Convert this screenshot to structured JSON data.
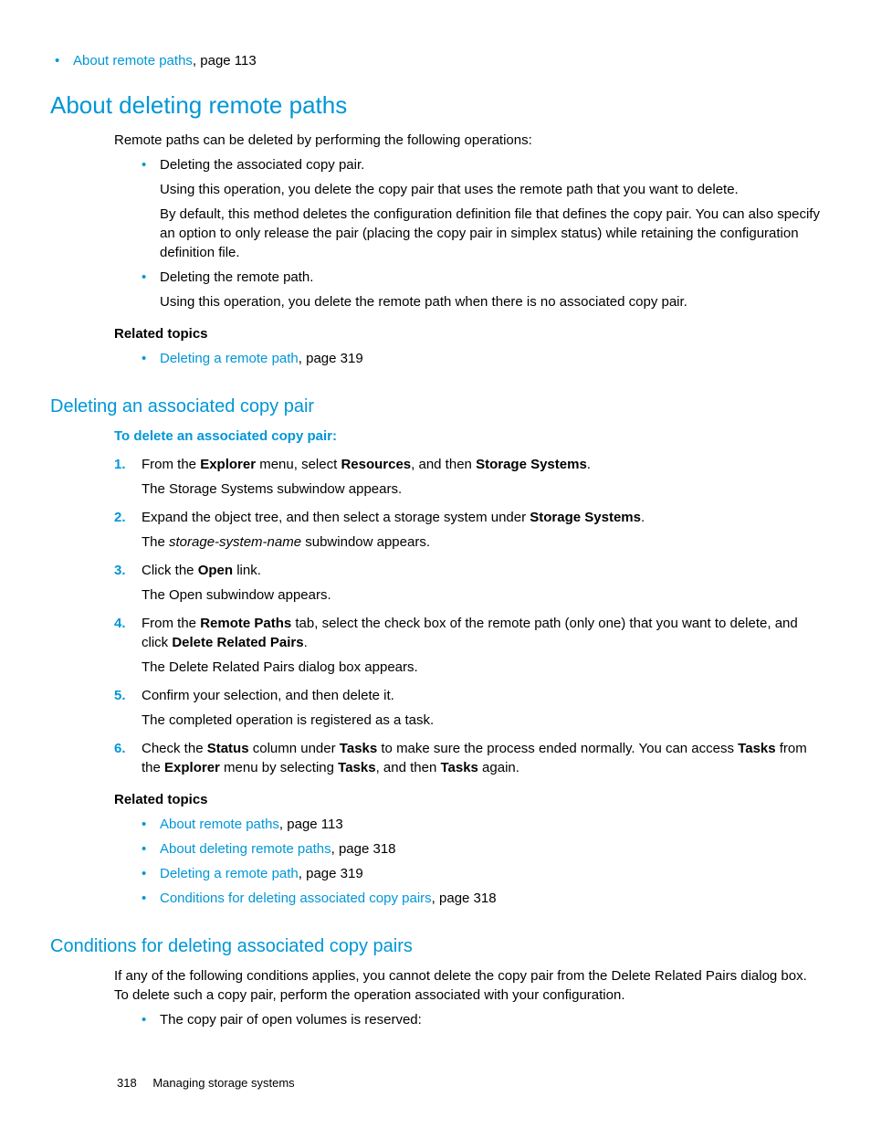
{
  "topRelated": {
    "link": "About remote paths",
    "suffix": ", page 113"
  },
  "h1": "About deleting remote paths",
  "intro": "Remote paths can be deleted by performing the following operations:",
  "ops": [
    {
      "title": "Deleting the associated copy pair.",
      "p1": "Using this operation, you delete the copy pair that uses the remote path that you want to delete.",
      "p2": "By default, this method deletes the configuration definition file that defines the copy pair. You can also specify an option to only release the pair (placing the copy pair in simplex status) while retaining the configuration definition file."
    },
    {
      "title": "Deleting the remote path.",
      "p1": "Using this operation, you delete the remote path when there is no associated copy pair."
    }
  ],
  "related1_head": "Related topics",
  "related1": {
    "link": "Deleting a remote path",
    "suffix": ", page 319"
  },
  "h2a": "Deleting an associated copy pair",
  "procHead": "To delete an associated copy pair:",
  "steps": {
    "s1": {
      "pre": "From the ",
      "b1": "Explorer",
      "mid1": " menu, select ",
      "b2": "Resources",
      "mid2": ", and then ",
      "b3": "Storage Systems",
      "post": ".",
      "result": "The Storage Systems subwindow appears."
    },
    "s2": {
      "pre": "Expand the object tree, and then select a storage system under ",
      "b1": "Storage Systems",
      "post": ".",
      "result_pre": "The ",
      "result_i": "storage-system-name",
      "result_post": " subwindow appears."
    },
    "s3": {
      "pre": "Click the ",
      "b1": "Open",
      "post": " link.",
      "result": "The Open subwindow appears."
    },
    "s4": {
      "pre": "From the ",
      "b1": "Remote Paths",
      "mid": " tab, select the check box of the remote path (only one) that you want to delete, and click ",
      "b2": "Delete Related Pairs",
      "post": ".",
      "result": "The Delete Related Pairs dialog box appears."
    },
    "s5": {
      "text": "Confirm your selection, and then delete it.",
      "result": "The completed operation is registered as a task."
    },
    "s6": {
      "pre": "Check the ",
      "b1": "Status",
      "mid1": " column under ",
      "b2": "Tasks",
      "mid2": " to make sure the process ended normally. You can access ",
      "b3": "Tasks",
      "mid3": " from the ",
      "b4": "Explorer",
      "mid4": " menu by selecting ",
      "b5": "Tasks",
      "mid5": ", and then ",
      "b6": "Tasks",
      "post": " again."
    }
  },
  "related2_head": "Related topics",
  "related2": [
    {
      "link": "About remote paths",
      "suffix": ", page 113"
    },
    {
      "link": "About deleting remote paths",
      "suffix": ", page 318"
    },
    {
      "link": "Deleting a remote path",
      "suffix": ", page 319"
    },
    {
      "link": "Conditions for deleting associated copy pairs",
      "suffix": ", page 318"
    }
  ],
  "h2b": "Conditions for deleting associated copy pairs",
  "cond_intro": "If any of the following conditions applies, you cannot delete the copy pair from the Delete Related Pairs dialog box. To delete such a copy pair, perform the operation associated with your configuration.",
  "cond_b1": "The copy pair of open volumes is reserved:",
  "footer": {
    "page": "318",
    "title": "Managing storage systems"
  },
  "nums": {
    "n1": "1.",
    "n2": "2.",
    "n3": "3.",
    "n4": "4.",
    "n5": "5.",
    "n6": "6."
  }
}
